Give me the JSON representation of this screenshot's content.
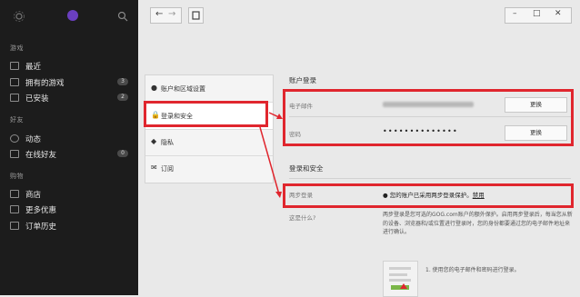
{
  "sidebar": {
    "icons": {
      "settings": "gear-icon",
      "profile": "user-icon",
      "search": "search-icon"
    },
    "sections": [
      {
        "title": "游戏",
        "items": [
          {
            "label": "最近",
            "badge": "",
            "icon": "recent-icon"
          },
          {
            "label": "拥有的游戏",
            "badge": "3",
            "icon": "library-icon"
          },
          {
            "label": "已安装",
            "badge": "2",
            "icon": "installed-icon"
          }
        ]
      },
      {
        "title": "好友",
        "items": [
          {
            "label": "动态",
            "badge": "",
            "icon": "activity-icon"
          },
          {
            "label": "在线好友",
            "badge": "0",
            "icon": "friends-icon"
          }
        ]
      },
      {
        "title": "购物",
        "items": [
          {
            "label": "商店",
            "badge": "",
            "icon": "store-icon"
          },
          {
            "label": "更多优惠",
            "badge": "",
            "icon": "tag-icon"
          },
          {
            "label": "订单历史",
            "badge": "",
            "icon": "orders-icon"
          }
        ]
      }
    ]
  },
  "settings_nav": [
    {
      "label": "账户和区域设置",
      "icon": "user-icon"
    },
    {
      "label": "登录和安全",
      "icon": "lock-icon"
    },
    {
      "label": "隐私",
      "icon": "privacy-icon"
    },
    {
      "label": "订阅",
      "icon": "mail-icon"
    }
  ],
  "account_login": {
    "title": "账户登录",
    "email_label": "电子邮件",
    "email_change": "更换",
    "password_label": "密码",
    "password_mask": "••••••••••••••",
    "password_change": "更换"
  },
  "login_security": {
    "title": "登录和安全",
    "two_step_label": "两步登录",
    "two_step_status": "您的账户已采用两步登录保护。",
    "two_step_action": "禁用",
    "what_label": "这是什么?",
    "description": "两步登录是您可选的GOG.com账户的额外保护。启用两步登录后，每当您从新的设备、浏览器和/或位置进行登录时，您的身份都要通过您的电子邮件地址来进行确认。",
    "step1": "1. 使用您的电子邮件和密码进行登录。"
  },
  "annotation_color": "#e0262e"
}
